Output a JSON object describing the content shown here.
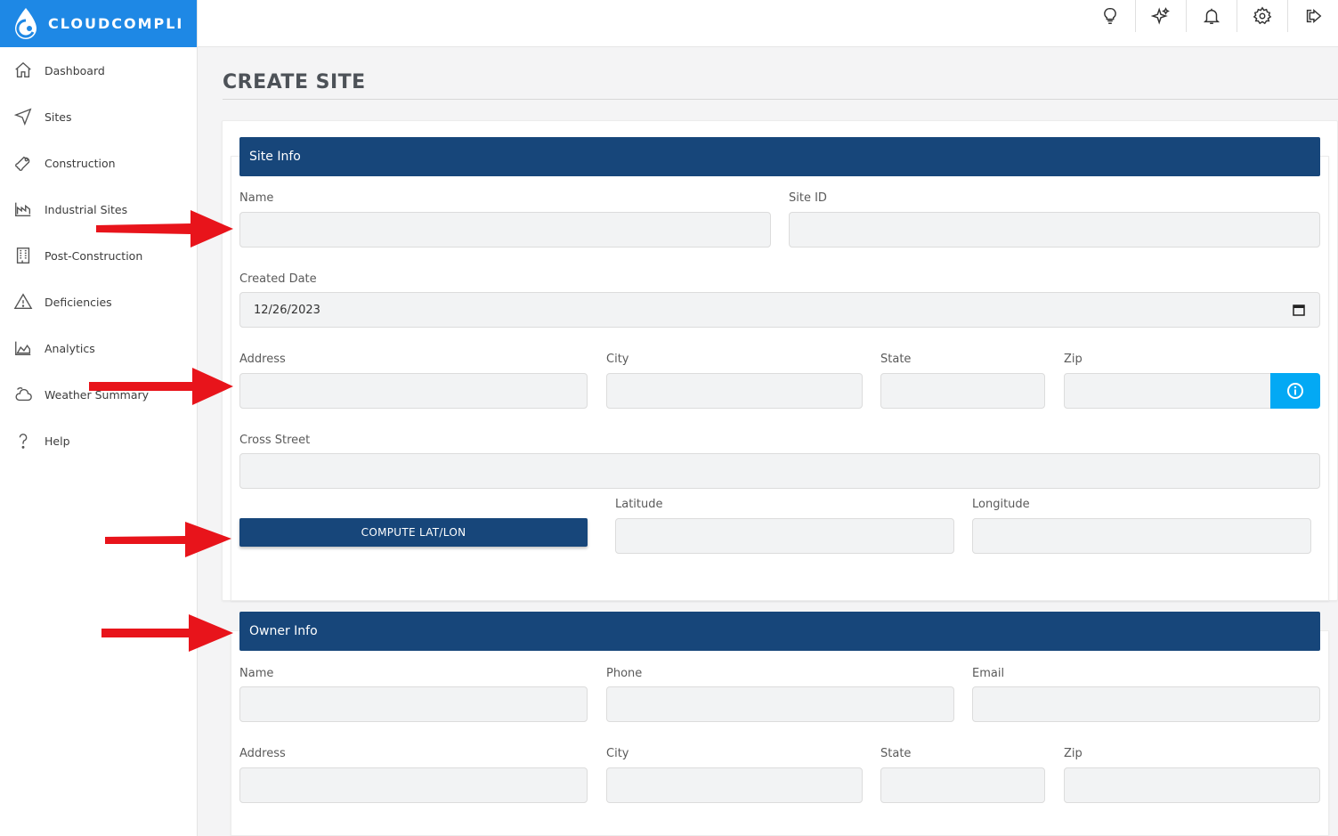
{
  "brand": {
    "name": "CLOUDCOMPLI"
  },
  "sidebar": {
    "items": [
      {
        "label": "Dashboard",
        "icon": "home-icon"
      },
      {
        "label": "Sites",
        "icon": "navigation-icon"
      },
      {
        "label": "Construction",
        "icon": "wrench-icon"
      },
      {
        "label": "Industrial Sites",
        "icon": "factory-icon"
      },
      {
        "label": "Post-Construction",
        "icon": "building-icon"
      },
      {
        "label": "Deficiencies",
        "icon": "warning-icon"
      },
      {
        "label": "Analytics",
        "icon": "area-chart-icon"
      },
      {
        "label": "Weather Summary",
        "icon": "cloud-sun-icon"
      },
      {
        "label": "Help",
        "icon": "question-icon"
      }
    ]
  },
  "topbar": {
    "icons": [
      "lightbulb-icon",
      "sparkles-icon",
      "bell-icon",
      "gear-icon",
      "logout-icon"
    ]
  },
  "page": {
    "title": "CREATE SITE"
  },
  "site_info": {
    "header": "Site Info",
    "name_label": "Name",
    "name_value": "",
    "site_id_label": "Site ID",
    "site_id_value": "",
    "created_date_label": "Created Date",
    "created_date_value": "12/26/2023",
    "address_label": "Address",
    "city_label": "City",
    "state_label": "State",
    "zip_label": "Zip",
    "cross_street_label": "Cross Street",
    "compute_button": "COMPUTE LAT/LON",
    "latitude_label": "Latitude",
    "longitude_label": "Longitude"
  },
  "owner_info": {
    "header": "Owner Info",
    "name_label": "Name",
    "phone_label": "Phone",
    "email_label": "Email",
    "address_label": "Address",
    "city_label": "City",
    "state_label": "State",
    "zip_label": "Zip"
  },
  "colors": {
    "brand_blue": "#1e88e5",
    "section_navy": "#17467a",
    "info_button": "#03a9f4",
    "annotation_arrow": "#e8141b"
  }
}
